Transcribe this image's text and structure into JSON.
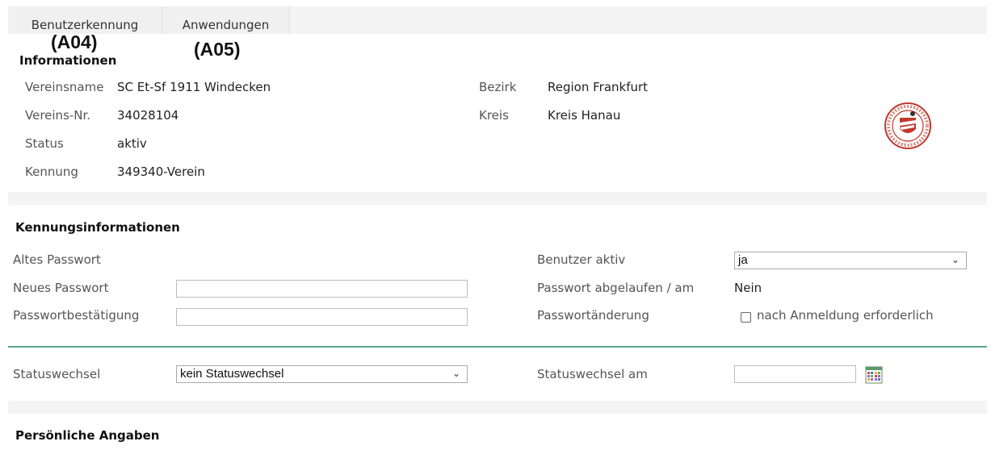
{
  "tabs": [
    {
      "label": "Benutzerkennung",
      "tag": "(A04)"
    },
    {
      "label": "Anwendungen",
      "tag": "(A05)"
    }
  ],
  "info": {
    "heading": "Informationen",
    "vereinsname_label": "Vereinsname",
    "vereinsname": "SC Et-Sf 1911 Windecken",
    "vereinsnr_label": "Vereins-Nr.",
    "vereinsnr": "34028104",
    "status_label": "Status",
    "status": "aktiv",
    "kennung_label": "Kennung",
    "kennung": "349340-Verein",
    "bezirk_label": "Bezirk",
    "bezirk": "Region Frankfurt",
    "kreis_label": "Kreis",
    "kreis": "Kreis Hanau",
    "logo_icon": "club-crest-icon",
    "logo_text": "SPORTFREUNDE 1911 WINDECKEN"
  },
  "kennung": {
    "heading": "Kennungsinformationen",
    "altes_passwort_label": "Altes Passwort",
    "neues_passwort_label": "Neues Passwort",
    "neues_passwort_value": "",
    "bestaetigung_label": "Passwortbestätigung",
    "bestaetigung_value": "",
    "benutzer_aktiv_label": "Benutzer aktiv",
    "benutzer_aktiv_value": "ja",
    "abgelaufen_label": "Passwort abgelaufen / am",
    "abgelaufen_value": "Nein",
    "aenderung_label": "Passwortänderung",
    "aenderung_checkbox_label": "nach Anmeldung erforderlich"
  },
  "statuswechsel": {
    "label": "Statuswechsel",
    "value": "kein Statuswechsel",
    "am_label": "Statuswechsel am",
    "am_value": "",
    "calendar_icon": "calendar-icon"
  },
  "persoenlich": {
    "heading": "Persönliche Angaben"
  },
  "colors": {
    "divider": "#5aa58b",
    "band": "#f4f4f4"
  }
}
